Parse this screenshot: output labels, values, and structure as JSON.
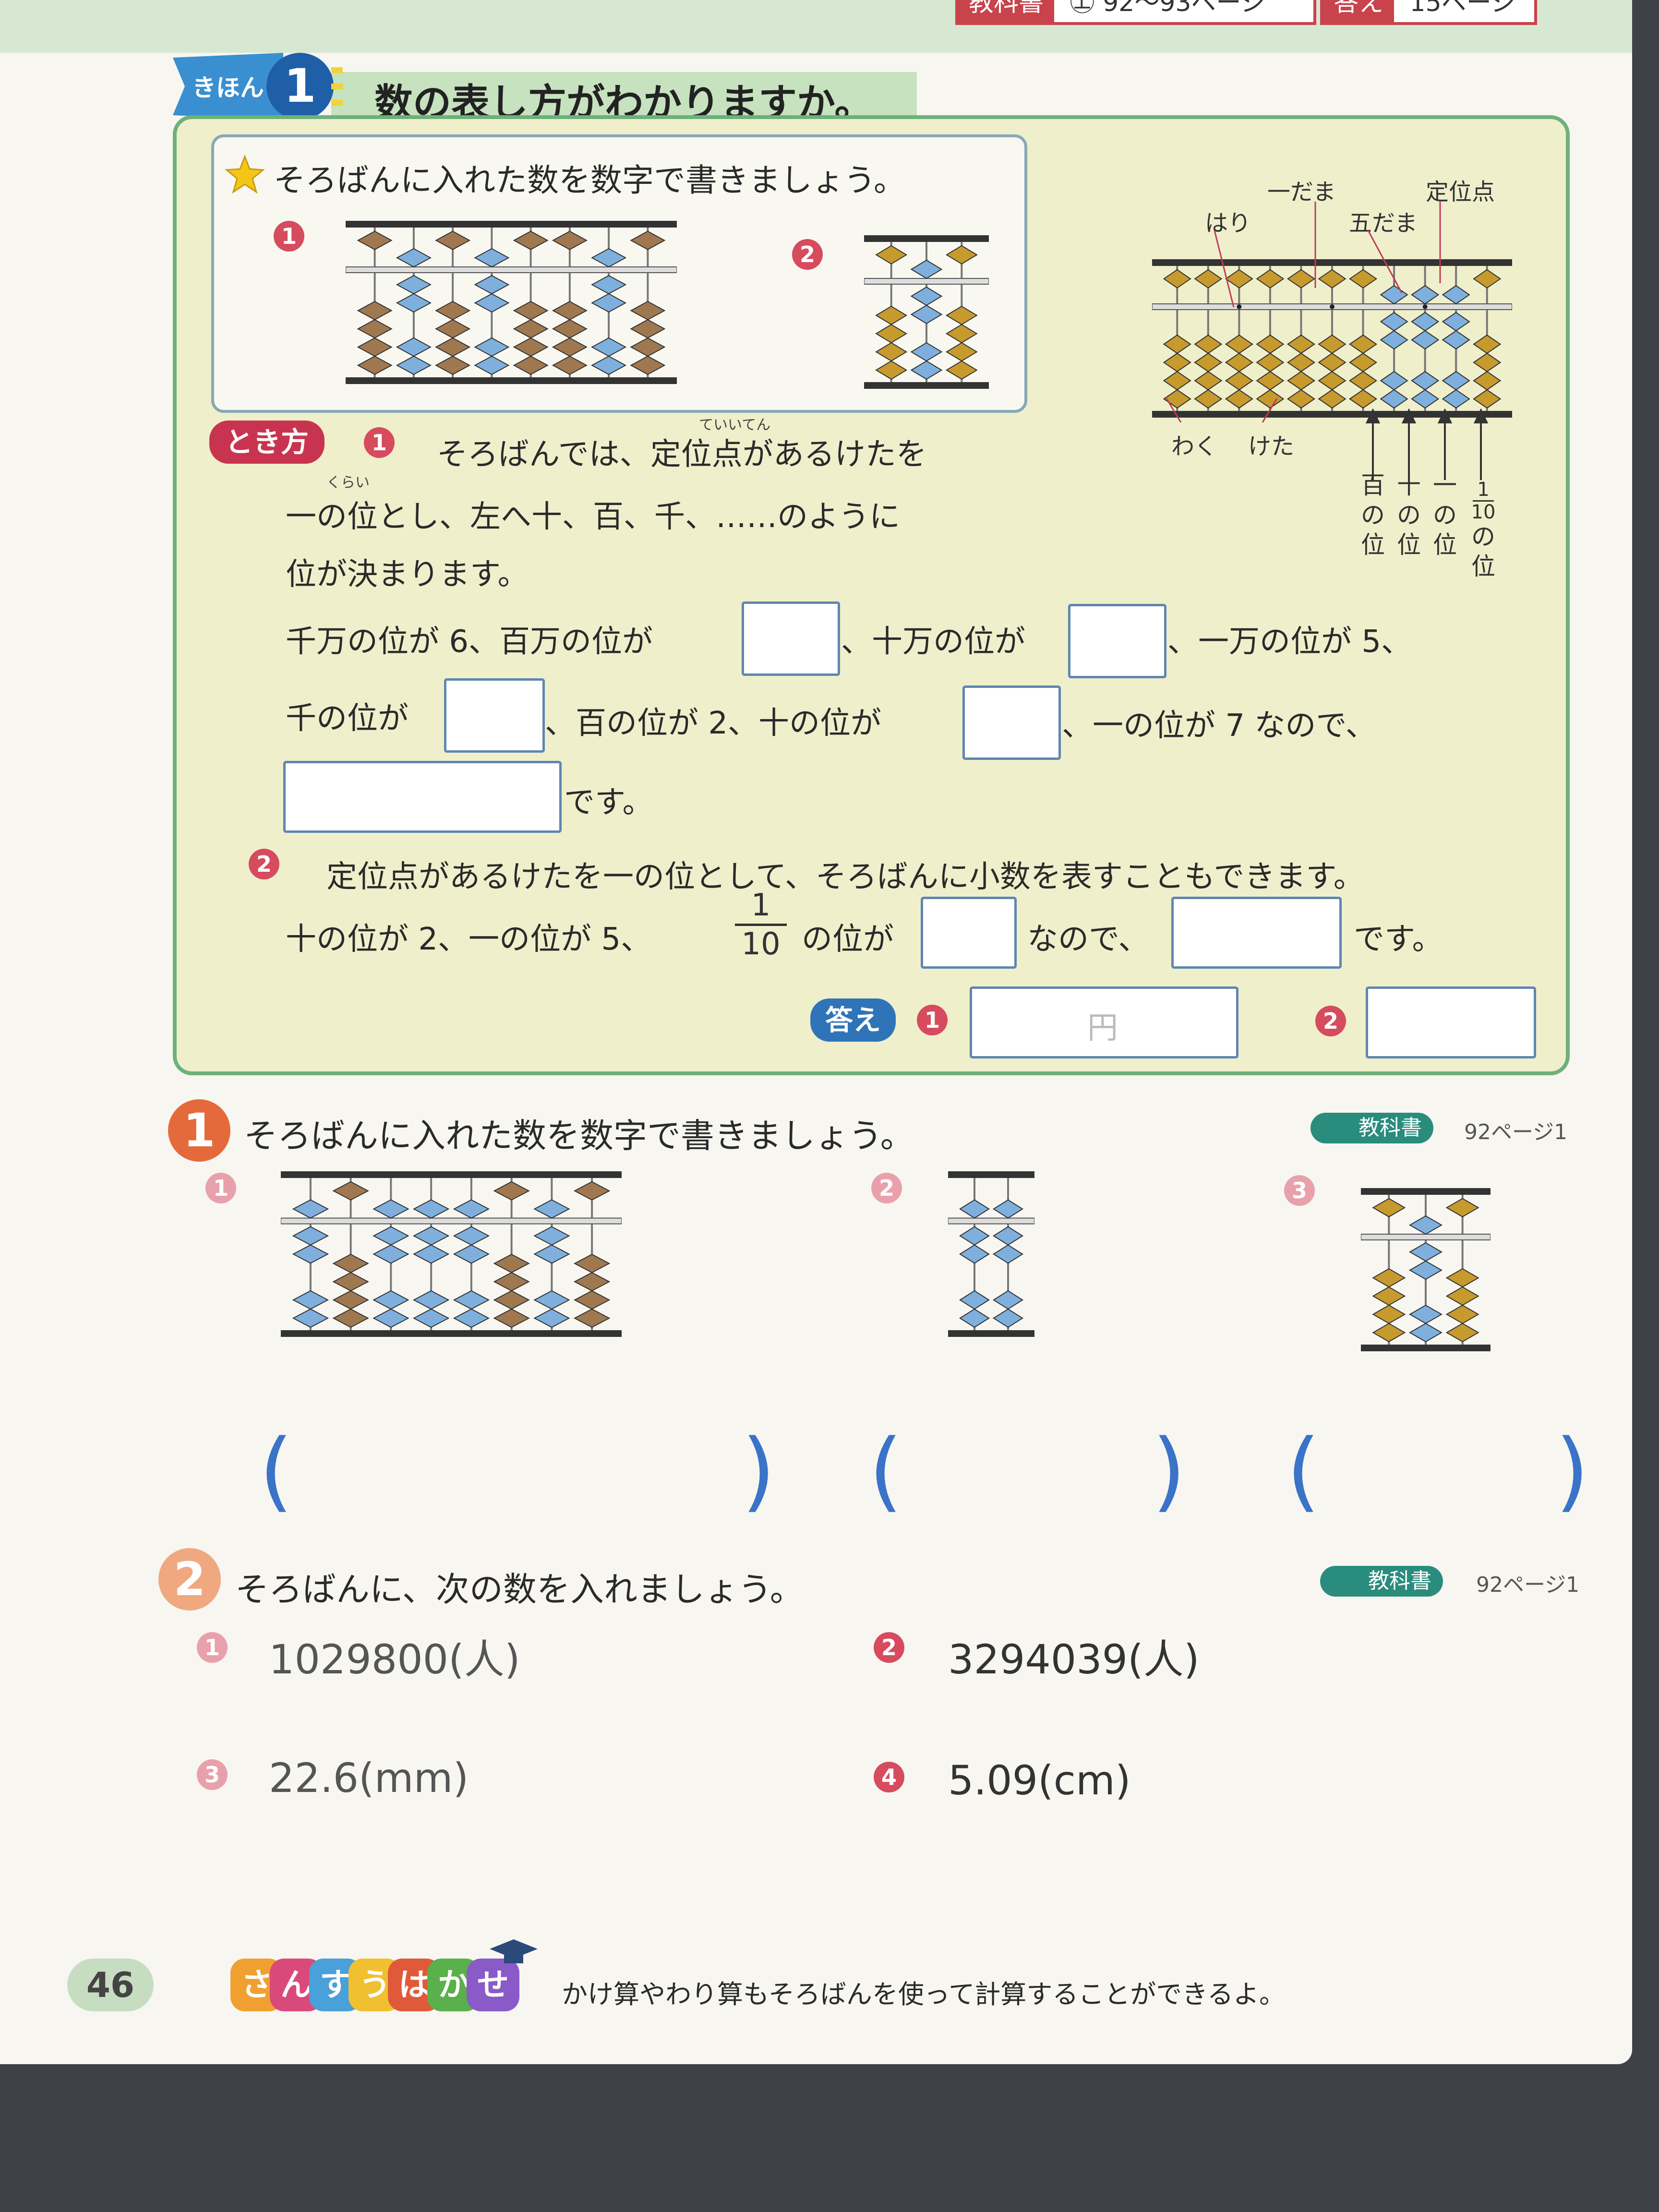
{
  "header": {
    "textbook_tag": "教科書",
    "textbook_pages": "㊤ 92〜93ページ",
    "answer_tag": "答え",
    "answer_page": "15ページ"
  },
  "kihon": {
    "tab_label": "きほん",
    "tab_number": "1",
    "title": "数の表し方がわかりますか。"
  },
  "problem": {
    "instruction": "そろばんに入れた数を数字で書きましょう。",
    "num1": "1",
    "num2": "2"
  },
  "diagram": {
    "label_hari": "はり",
    "label_ichidama": "一だま",
    "label_godama": "五だま",
    "label_teiiten": "定位点",
    "label_waku": "わく",
    "label_keta": "けた",
    "place_hyaku": "百の位",
    "place_juu": "十の位",
    "place_ichi": "一の位",
    "place_tenth_num": "1",
    "place_tenth_den": "10",
    "place_tenth_suffix": "の位"
  },
  "tokikata": {
    "label": "とき方",
    "ruby_teiiten": "ていいてん",
    "ruby_kurai": "くらい",
    "p1_line1": "そろばんでは、定位点があるけたを",
    "p1_line2": "一の位とし、左へ十、百、千、……のように",
    "p1_line3": "位が決まります。",
    "line4a": "千万の位が 6、百万の位が",
    "line4b": "、十万の位が",
    "line4c": "、一万の位が 5、",
    "line5a": "千の位が",
    "line5b": "、百の位が 2、十の位が",
    "line5c": "、一の位が 7 なので、",
    "line6": "です。",
    "p2_line1": "定位点があるけたを一の位として、そろばんに小数を表すこともできます。",
    "p2_line2a": "十の位が 2、一の位が 5、",
    "p2_frac_num": "1",
    "p2_frac_den": "10",
    "p2_line2b": "の位が",
    "p2_line2c": "なので、",
    "p2_line2d": "です。",
    "answer_label": "答え",
    "answer_unit": "円"
  },
  "q1": {
    "number": "1",
    "instruction": "そろばんに入れた数を数字で書きましょう。",
    "textbook_tag": "教科書",
    "textbook_ref": "92ページ1",
    "items": [
      "1",
      "2",
      "3"
    ]
  },
  "q2": {
    "number": "2",
    "instruction": "そろばんに、次の数を入れましょう。",
    "textbook_tag": "教科書",
    "textbook_ref": "92ページ1",
    "items": [
      {
        "num": "1",
        "value": "1029800(人)"
      },
      {
        "num": "2",
        "value": "3294039(人)"
      },
      {
        "num": "3",
        "value": "22.6(mm)"
      },
      {
        "num": "4",
        "value": "5.09(cm)"
      }
    ]
  },
  "footer": {
    "page_number": "46",
    "hakase_chars": [
      "さ",
      "ん",
      "す",
      "う",
      "は",
      "か",
      "せ"
    ],
    "hakase_colors": [
      "#f0a030",
      "#d94a7a",
      "#4aa0d8",
      "#f0c030",
      "#e05a3a",
      "#5ab04a",
      "#8a5ac8"
    ],
    "tip": "かけ算やわり算もそろばんを使って計算することができるよ。"
  },
  "colors": {
    "brown_bead": "#a07850",
    "blue_bead": "#7fb0dd",
    "gold_bead": "#c79a2e",
    "frame": "#333333"
  }
}
